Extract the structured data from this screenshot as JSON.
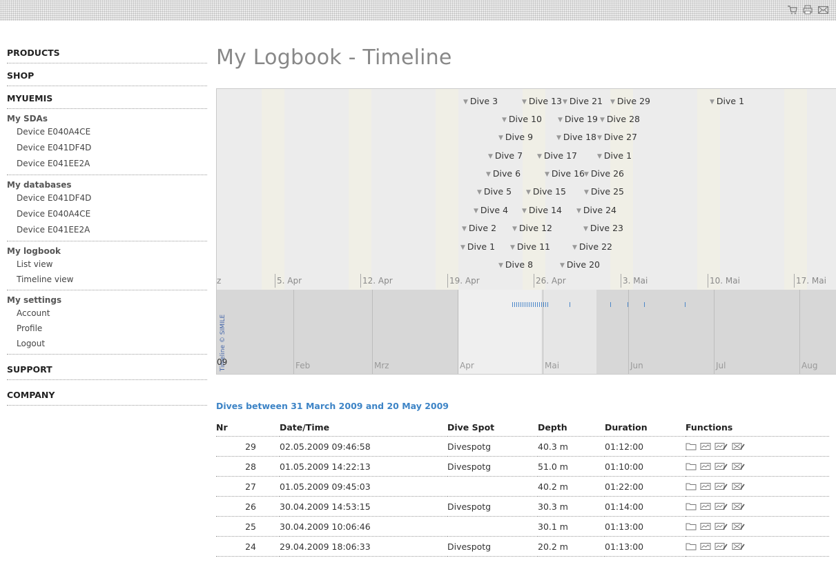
{
  "sidebar": {
    "products": "PRODUCTS",
    "shop": "SHOP",
    "myuemis": "MYUEMIS",
    "sdas": {
      "title": "My SDAs",
      "items": [
        "Device E040A4CE",
        "Device E041DF4D",
        "Device E041EE2A"
      ]
    },
    "databases": {
      "title": "My databases",
      "items": [
        "Device E041DF4D",
        "Device E040A4CE",
        "Device E041EE2A"
      ]
    },
    "logbook": {
      "title": "My logbook",
      "items": [
        "List view",
        "Timeline view"
      ]
    },
    "settings": {
      "title": "My settings",
      "items": [
        "Account",
        "Profile",
        "Logout"
      ]
    },
    "support": "SUPPORT",
    "company": "COMPANY"
  },
  "page_title": "My Logbook - Timeline",
  "timeline": {
    "credit": "Timeline © SIMILE",
    "year_fragment": "09",
    "upper_ticks": [
      "z",
      "5. Apr",
      "12. Apr",
      "19. Apr",
      "26. Apr",
      "3. Mai",
      "10. Mai",
      "17. Mai"
    ],
    "lower_months": [
      "Feb",
      "Mrz",
      "Apr",
      "Mai",
      "Jun",
      "Jul",
      "Aug"
    ],
    "events": [
      "Dive 3",
      "Dive 13",
      "Dive 21",
      "Dive 29",
      "Dive 1",
      "Dive 10",
      "Dive 19",
      "Dive 28",
      "Dive 9",
      "Dive 18",
      "Dive 27",
      "Dive 7",
      "Dive 17",
      "Dive 1",
      "Dive 6",
      "Dive 16",
      "Dive 26",
      "Dive 5",
      "Dive 15",
      "Dive 25",
      "Dive 4",
      "Dive 14",
      "Dive 24",
      "Dive 2",
      "Dive 12",
      "Dive 23",
      "Dive 1",
      "Dive 11",
      "Dive 22",
      "Dive 8",
      "Dive 20"
    ]
  },
  "dives_heading": "Dives between 31 March 2009 and 20 May 2009",
  "table": {
    "headers": {
      "nr": "Nr",
      "date": "Date/Time",
      "spot": "Dive Spot",
      "depth": "Depth",
      "duration": "Duration",
      "functions": "Functions"
    },
    "rows": [
      {
        "nr": "29",
        "date": "02.05.2009 09:46:58",
        "spot": "Divespotg",
        "depth": "40.3 m",
        "duration": "01:12:00"
      },
      {
        "nr": "28",
        "date": "01.05.2009 14:22:13",
        "spot": "Divespotg",
        "depth": "51.0 m",
        "duration": "01:10:00"
      },
      {
        "nr": "27",
        "date": "01.05.2009 09:45:03",
        "spot": "",
        "depth": "40.2 m",
        "duration": "01:22:00"
      },
      {
        "nr": "26",
        "date": "30.04.2009 14:53:15",
        "spot": "Divespotg",
        "depth": "30.3 m",
        "duration": "01:14:00"
      },
      {
        "nr": "25",
        "date": "30.04.2009 10:06:46",
        "spot": "",
        "depth": "30.1 m",
        "duration": "01:13:00"
      },
      {
        "nr": "24",
        "date": "29.04.2009 18:06:33",
        "spot": "Divespotg",
        "depth": "20.2 m",
        "duration": "01:13:00"
      }
    ]
  },
  "colors": {
    "accent": "#3d84c6",
    "title_grey": "#888888",
    "timeline_bg": "#ececec"
  },
  "icons": [
    "cart-icon",
    "print-icon",
    "mail-icon",
    "folder-icon",
    "profile-graph-icon",
    "edit-graph-icon",
    "delete-icon"
  ]
}
